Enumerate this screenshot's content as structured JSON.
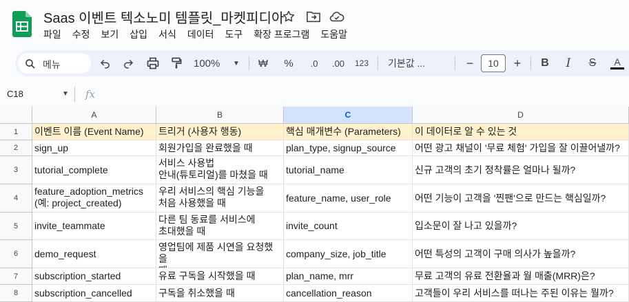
{
  "app": {
    "title": "Saas 이벤트 텍소노미 템플릿_마켓피디아",
    "accent": "#0f9d58"
  },
  "menu": [
    "파일",
    "수정",
    "보기",
    "삽입",
    "서식",
    "데이터",
    "도구",
    "확장 프로그램",
    "도움말"
  ],
  "toolbar": {
    "search_label": "메뉴",
    "zoom": "100%",
    "currency": "₩",
    "percent": "%",
    "dec_decrease": ".0",
    "dec_increase": ".00",
    "number_format": "123",
    "font": "기본값 ...",
    "font_size": "10",
    "bold": "B",
    "italic": "I",
    "strike": "S",
    "text_color": "A"
  },
  "formula_bar": {
    "cell_ref": "C18",
    "fx": "fx",
    "value": ""
  },
  "columns": [
    "A",
    "B",
    "C",
    "D"
  ],
  "selected_column": "C",
  "rows": [
    {
      "n": "1",
      "cells": [
        "이벤트 이름 (Event Name)",
        "트리거 (사용자 행동)",
        "핵심 매개변수 (Parameters)",
        "이 데이터로 알 수 있는 것"
      ]
    },
    {
      "n": "2",
      "cells": [
        "sign_up",
        "회원가입을 완료했을 때",
        "plan_type, signup_source",
        "어떤 광고 채널이 '무료 체험' 가입을 잘 이끌어낼까?"
      ]
    },
    {
      "n": "3",
      "cells": [
        "tutorial_complete",
        "서비스 사용법\n안내(튜토리얼)를 마쳤을 때",
        "tutorial_name",
        "신규 고객의 초기 정착률은 얼마나 될까?"
      ]
    },
    {
      "n": "4",
      "cells": [
        "feature_adoption_metrics\n(예: project_created)",
        "우리 서비스의 핵심 기능을\n처음 사용했을 때",
        "feature_name, user_role",
        "어떤 기능이 고객을 '찐팬'으로 만드는 핵심일까?"
      ]
    },
    {
      "n": "5",
      "cells": [
        "invite_teammate",
        "다른 팀 동료를 서비스에\n초대했을 때",
        "invite_count",
        "입소문이 잘 나고 있을까?"
      ]
    },
    {
      "n": "6",
      "cells": [
        "demo_request",
        "영업팀에 제품 시연을 요청했을\n때",
        "company_size, job_title",
        "어떤 특성의 고객이 구매 의사가 높을까?"
      ]
    },
    {
      "n": "7",
      "cells": [
        "subscription_started",
        "유료 구독을 시작했을 때",
        "plan_name, mrr",
        "무료 고객의 유료 전환율과 월 매출(MRR)은?"
      ]
    },
    {
      "n": "8",
      "cells": [
        "subscription_cancelled",
        "구독을 취소했을 때",
        "cancellation_reason",
        "고객들이 우리 서비스를 떠나는 주된 이유는 뭘까?"
      ]
    }
  ]
}
